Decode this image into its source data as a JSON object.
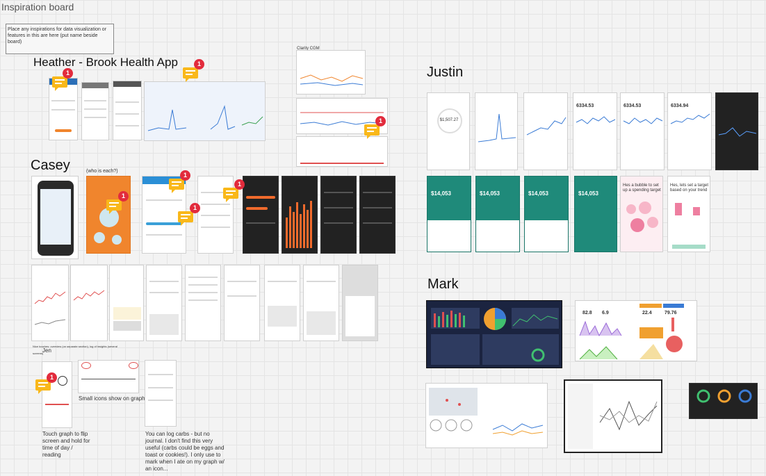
{
  "board": {
    "title": "Inspiration board",
    "instructions": "Place any inspirations for data visualization or features in this are here (put name beside board)"
  },
  "sections": {
    "heather": {
      "title": "Heather - Brook Health App"
    },
    "casey": {
      "title": "Casey",
      "subtitle": "(who is each?)"
    },
    "justin": {
      "title": "Justin"
    },
    "mark": {
      "title": "Mark"
    },
    "jen": {
      "title": "Jen"
    }
  },
  "captions": {
    "clarity": "Clarity CGM",
    "small_icons": "Small icons show on graph",
    "touch_graph": "Touch graph to flip screen and hold for time of day / reading",
    "log_carbs": "You can log carbs - but no journal. I don't find this very useful (carbs could be eggs and toast or cookies!). I only use to mark when I ate on my graph w/ an icon...",
    "fine_print": "Nice touches: overview (on separate section), log of insights (several screens)"
  },
  "comments": {
    "count_label": "1"
  },
  "colors": {
    "comment": "#f9b81a",
    "badge": "#e22b3c",
    "teal": "#1f8a7a",
    "dark": "#222222"
  },
  "justin_values": {
    "v1": "$1,507.27",
    "v2": "6334.53",
    "v3": "6334.53",
    "v4": "6334.94",
    "teal_amount": "$14,053",
    "pink_heading": "Hes a bubble to set up a spending target",
    "pink_heading_2": "Hes, lets set a target based on your trend"
  },
  "mark_values": {
    "m1": "82.8",
    "m2": "6.9",
    "m3": "22.4",
    "m4": "79.76"
  }
}
